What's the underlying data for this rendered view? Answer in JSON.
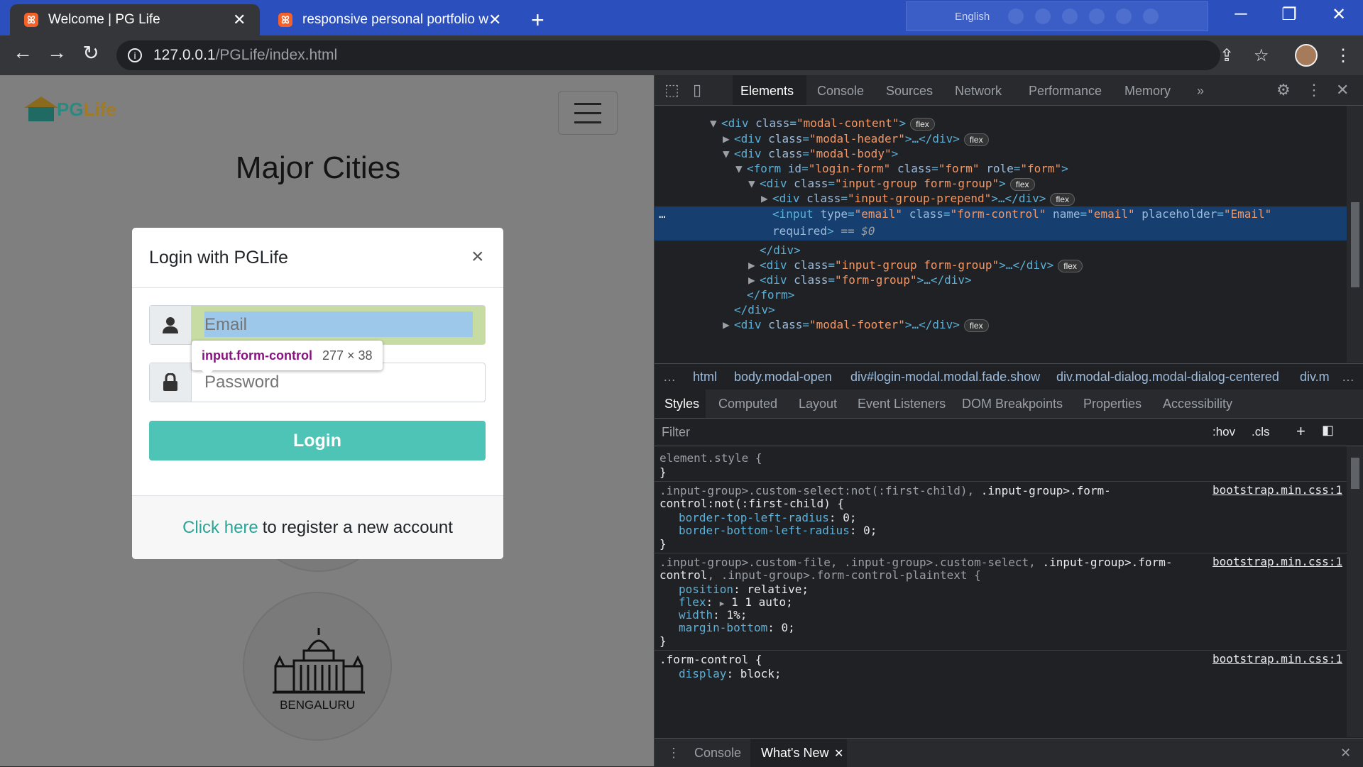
{
  "browser": {
    "tabs": [
      {
        "title": "Welcome | PG Life",
        "active": true
      },
      {
        "title": "responsive personal portfolio web",
        "active": false
      }
    ],
    "new_tab_icon": "plus-icon",
    "ime": {
      "language": "English"
    },
    "address": {
      "host": "127.0.0.1",
      "path": "/PGLife/index.html"
    },
    "window_controls": {
      "minimize": "─",
      "restore": "❐",
      "close": "✕"
    }
  },
  "page": {
    "logo": {
      "pg": "PG",
      "life": "Life"
    },
    "heading": "Major Cities",
    "city_label": "BENGALURU",
    "modal": {
      "title": "Login with PGLife",
      "close_symbol": "×",
      "email_placeholder": "Email",
      "password_placeholder": "Password",
      "login_label": "Login",
      "footer_link": "Click here",
      "footer_text": "to register a new account"
    },
    "inspect_tooltip": {
      "selector": "input.form-control",
      "size": "277 × 38"
    }
  },
  "devtools": {
    "tabs": [
      "Elements",
      "Console",
      "Sources",
      "Network",
      "Performance",
      "Memory"
    ],
    "more": "»",
    "dom_lines": {
      "l1_tag_open": "<div ",
      "l1_attr": "class",
      "l1_val": "\"modal-content\"",
      "l1_close": ">",
      "l2_tag_open": "<div ",
      "l2_attr": "class",
      "l2_val": "\"modal-header\"",
      "l2_close": ">…</div>",
      "l3_tag_open": "<div ",
      "l3_attr": "class",
      "l3_val": "\"modal-body\"",
      "l3_close": ">",
      "l4_tag_open": "<form ",
      "l4_a1": "id",
      "l4_v1": "\"login-form\"",
      "l4_a2": "class",
      "l4_v2": "\"form\"",
      "l4_a3": "role",
      "l4_v3": "\"form\"",
      "l4_close": ">",
      "l5_tag_open": "<div ",
      "l5_attr": "class",
      "l5_val": "\"input-group form-group\"",
      "l5_close": ">",
      "l6_tag_open": "<div ",
      "l6_attr": "class",
      "l6_val": "\"input-group-prepend\"",
      "l6_close": ">…</div>",
      "l7_tag_open": "<input ",
      "l7_a1": "type",
      "l7_v1": "\"email\"",
      "l7_a2": "class",
      "l7_v2": "\"form-control\"",
      "l7_a3": "name",
      "l7_v3": "\"email\"",
      "l7_a4": "placeholder",
      "l7_v4": "\"Email\"",
      "l7b_attr": "required",
      "l7b_close": ">",
      "l7b_eq": "==",
      "l7b_dollar": "$0",
      "l8": "</div>",
      "l9_tag_open": "<div ",
      "l9_attr": "class",
      "l9_val": "\"input-group form-group\"",
      "l9_close": ">…</div>",
      "l10_tag_open": "<div ",
      "l10_attr": "class",
      "l10_val": "\"form-group\"",
      "l10_close": ">…</div>",
      "l11": "</form>",
      "l12": "</div>",
      "l13_tag_open": "<div ",
      "l13_attr": "class",
      "l13_val": "\"modal-footer\"",
      "l13_close": ">…</div>",
      "badge": "flex",
      "ellipsis": "…"
    },
    "breadcrumbs": [
      "html",
      "body.modal-open",
      "div#login-modal.modal.fade.show",
      "div.modal-dialog.modal-dialog-centered",
      "div.m"
    ],
    "style_tabs": [
      "Styles",
      "Computed",
      "Layout",
      "Event Listeners",
      "DOM Breakpoints",
      "Properties",
      "Accessibility"
    ],
    "filter_placeholder": "Filter",
    "filter_opts": {
      "hov": ":hov",
      "cls": ".cls",
      "plus": "+"
    },
    "styles": {
      "r0_sel": "element.style {",
      "close": "}",
      "r1_sel_a": ".input-group>.custom-select:not(:first-child), ",
      "r1_sel_b": ".input-group>.form-",
      "r1_sel_c": "control:not(:first-child) {",
      "r1_p1": "border-top-left-radius",
      "r1_v1": "0;",
      "r1_p2": "border-bottom-left-radius",
      "r1_v2": "0;",
      "r2_sel_a": ".input-group>.custom-file, .input-group>.custom-select, ",
      "r2_sel_b": ".input-group>.form-",
      "r2_sel_c": "control",
      "r2_sel_d": ", .input-group>.form-control-plaintext {",
      "r2_p1": "position",
      "r2_v1": "relative;",
      "r2_p2": "flex",
      "r2_v2": "1 1 auto;",
      "r2_p3": "width",
      "r2_v3": "1%;",
      "r2_p4": "margin-bottom",
      "r2_v4": "0;",
      "r3_sel": ".form-control {",
      "r3_p1": "display",
      "r3_v1": "block;",
      "source": "bootstrap.min.css:1"
    },
    "drawer": {
      "console": "Console",
      "whats_new": "What's New",
      "close": "✕"
    }
  }
}
